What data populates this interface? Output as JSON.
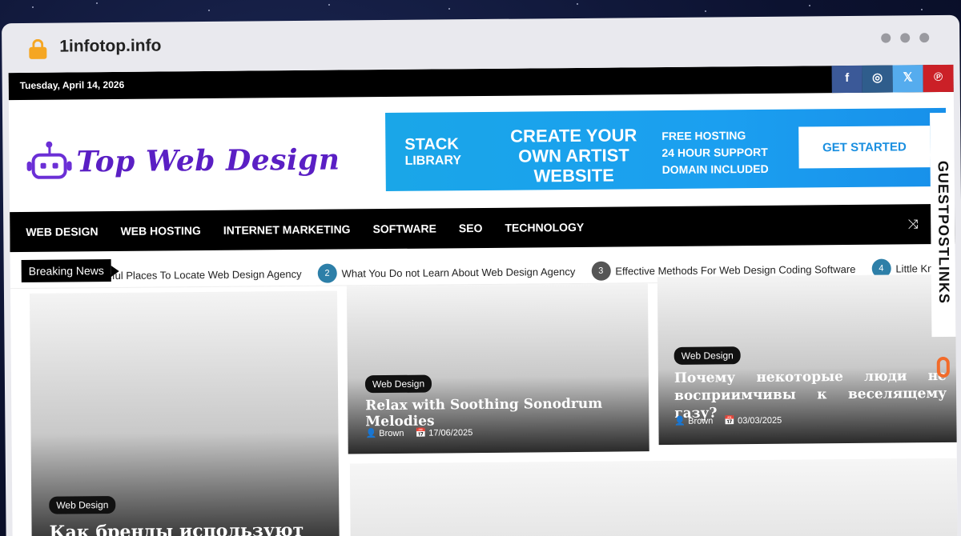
{
  "browser": {
    "url": "1infotop.info"
  },
  "topbar": {
    "date": "Tuesday, April 14, 2026",
    "socials": [
      {
        "name": "facebook-icon",
        "glyph": "f"
      },
      {
        "name": "instagram-icon",
        "glyph": "◎"
      },
      {
        "name": "x-icon",
        "glyph": "𝕏"
      },
      {
        "name": "pinterest-icon",
        "glyph": "℗"
      }
    ]
  },
  "logo": {
    "text": "Top Web Design"
  },
  "banner": {
    "brand_line1": "STACK",
    "brand_line2": "LIBRARY",
    "headline": "CREATE YOUR OWN ARTIST WEBSITE",
    "feature1": "FREE HOSTING",
    "feature2": "24 HOUR SUPPORT",
    "feature3": "DOMAIN INCLUDED",
    "button": "GET STARTED"
  },
  "nav": {
    "items": [
      "WEB DESIGN",
      "WEB HOSTING",
      "INTERNET MARKETING",
      "SOFTWARE",
      "SEO",
      "TECHNOLOGY"
    ],
    "shuffle_icon": "⤨",
    "search_icon": "⚲"
  },
  "ticker": {
    "label": "Breaking News",
    "items": [
      {
        "num": "",
        "text": "eful Places To Locate Web Design Agency"
      },
      {
        "num": "2",
        "text": "What You Do not Learn About Web Design Agency"
      },
      {
        "num": "3",
        "text": "Effective Methods For Web Design Coding Software"
      },
      {
        "num": "4",
        "text": "Little Known F"
      }
    ]
  },
  "cards": [
    {
      "tag": "Web Design",
      "title": "Как бренды используют"
    },
    {
      "tag": "Web Design",
      "title": "Relax with Soothing Sonodrum Melodies",
      "author": "Brown",
      "date": "17/06/2025"
    },
    {
      "tag": "Web Design",
      "title": "Почему некоторые люди не восприимчивы к веселящему газу?",
      "author": "Brown",
      "date": "03/03/2025"
    }
  ],
  "side_badge": {
    "text": "GUESTPOSTLINKS"
  }
}
